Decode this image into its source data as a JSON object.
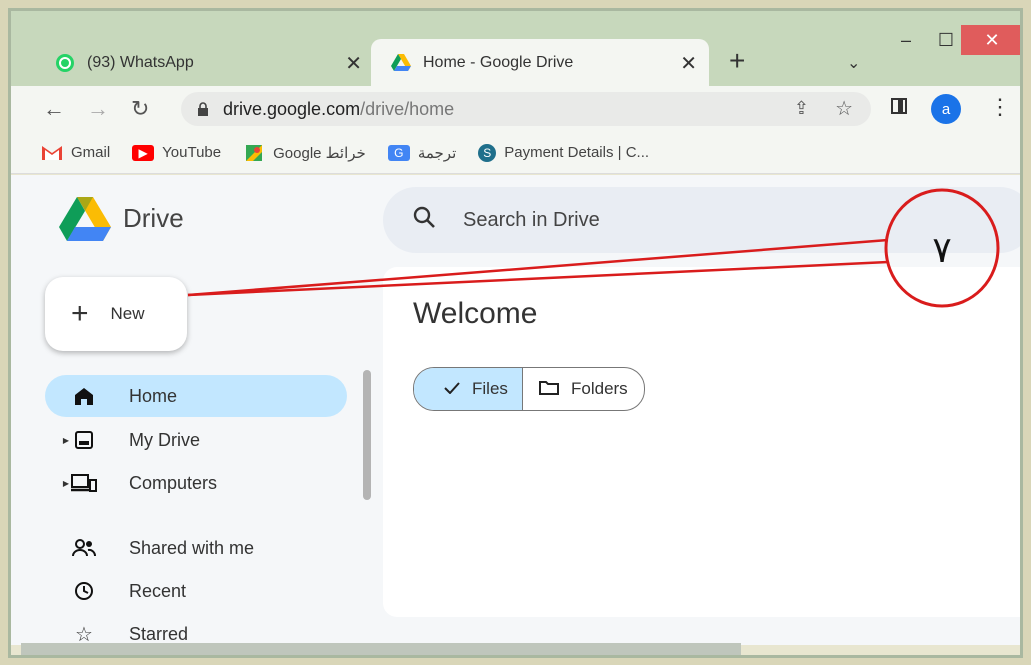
{
  "tabs": [
    {
      "title": "(93) WhatsApp",
      "icon": "whatsapp-icon",
      "active": false,
      "close": "✕"
    },
    {
      "title": "Home - Google Drive",
      "icon": "google-drive-icon",
      "active": true,
      "close": "✕"
    }
  ],
  "new_tab_label": "+",
  "address": {
    "domain": "drive.google.com",
    "path": "/drive/home"
  },
  "profile_initial": "a",
  "bookmarks": [
    {
      "label": "Gmail",
      "icon": "gmail-icon"
    },
    {
      "label": "YouTube",
      "icon": "youtube-icon"
    },
    {
      "label": "Google خرائط",
      "icon": "google-maps-icon"
    },
    {
      "label": "ترجمة",
      "icon": "google-translate-icon"
    },
    {
      "label": "Payment Details | C...",
      "icon": "payment-icon"
    }
  ],
  "drive": {
    "app_name": "Drive",
    "search_placeholder": "Search in Drive",
    "new_label": "New",
    "nav": [
      {
        "label": "Home",
        "icon": "home-icon",
        "selected": true
      },
      {
        "label": "My Drive",
        "icon": "my-drive-icon",
        "expandable": true
      },
      {
        "label": "Computers",
        "icon": "computers-icon",
        "expandable": true
      },
      {
        "label": "Shared with me",
        "icon": "shared-icon"
      },
      {
        "label": "Recent",
        "icon": "clock-icon"
      },
      {
        "label": "Starred",
        "icon": "star-icon"
      }
    ],
    "welcome": "Welcome",
    "filter": {
      "files": "Files",
      "folders": "Folders",
      "selected": "files"
    }
  },
  "annotation": {
    "number": "٧",
    "color": "#d91c1c"
  }
}
